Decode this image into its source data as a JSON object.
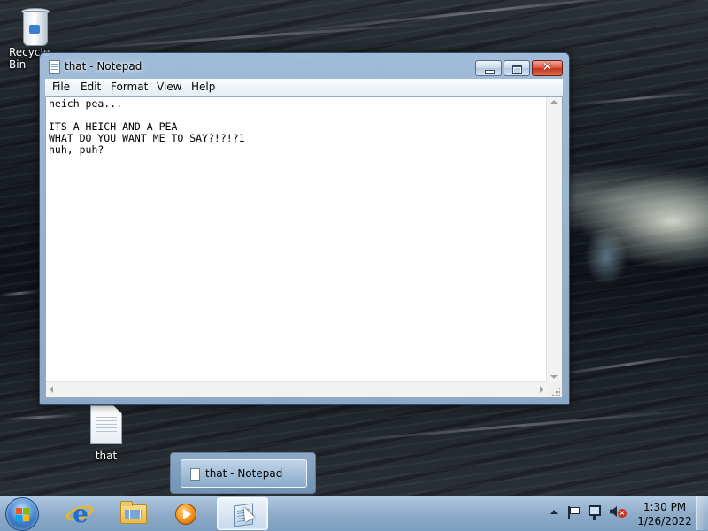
{
  "desktop": {
    "icons": [
      {
        "label": "Recycle Bin"
      },
      {
        "label": "that"
      }
    ]
  },
  "window": {
    "title": "that - Notepad",
    "menu": [
      "File",
      "Edit",
      "Format",
      "View",
      "Help"
    ],
    "content": "heich pea...\n\nITS A HEICH AND A PEA\nWHAT DO YOU WANT ME TO SAY?!?!?1\nhuh, puh?"
  },
  "taskbar": {
    "thumbnail_title": "that - Notepad",
    "pinned": [
      "internet-explorer-icon",
      "windows-explorer-icon",
      "media-player-icon",
      "notepad-icon"
    ],
    "active_app": "that - Notepad",
    "clock": {
      "time": "1:30 PM",
      "date": "1/26/2022"
    }
  }
}
